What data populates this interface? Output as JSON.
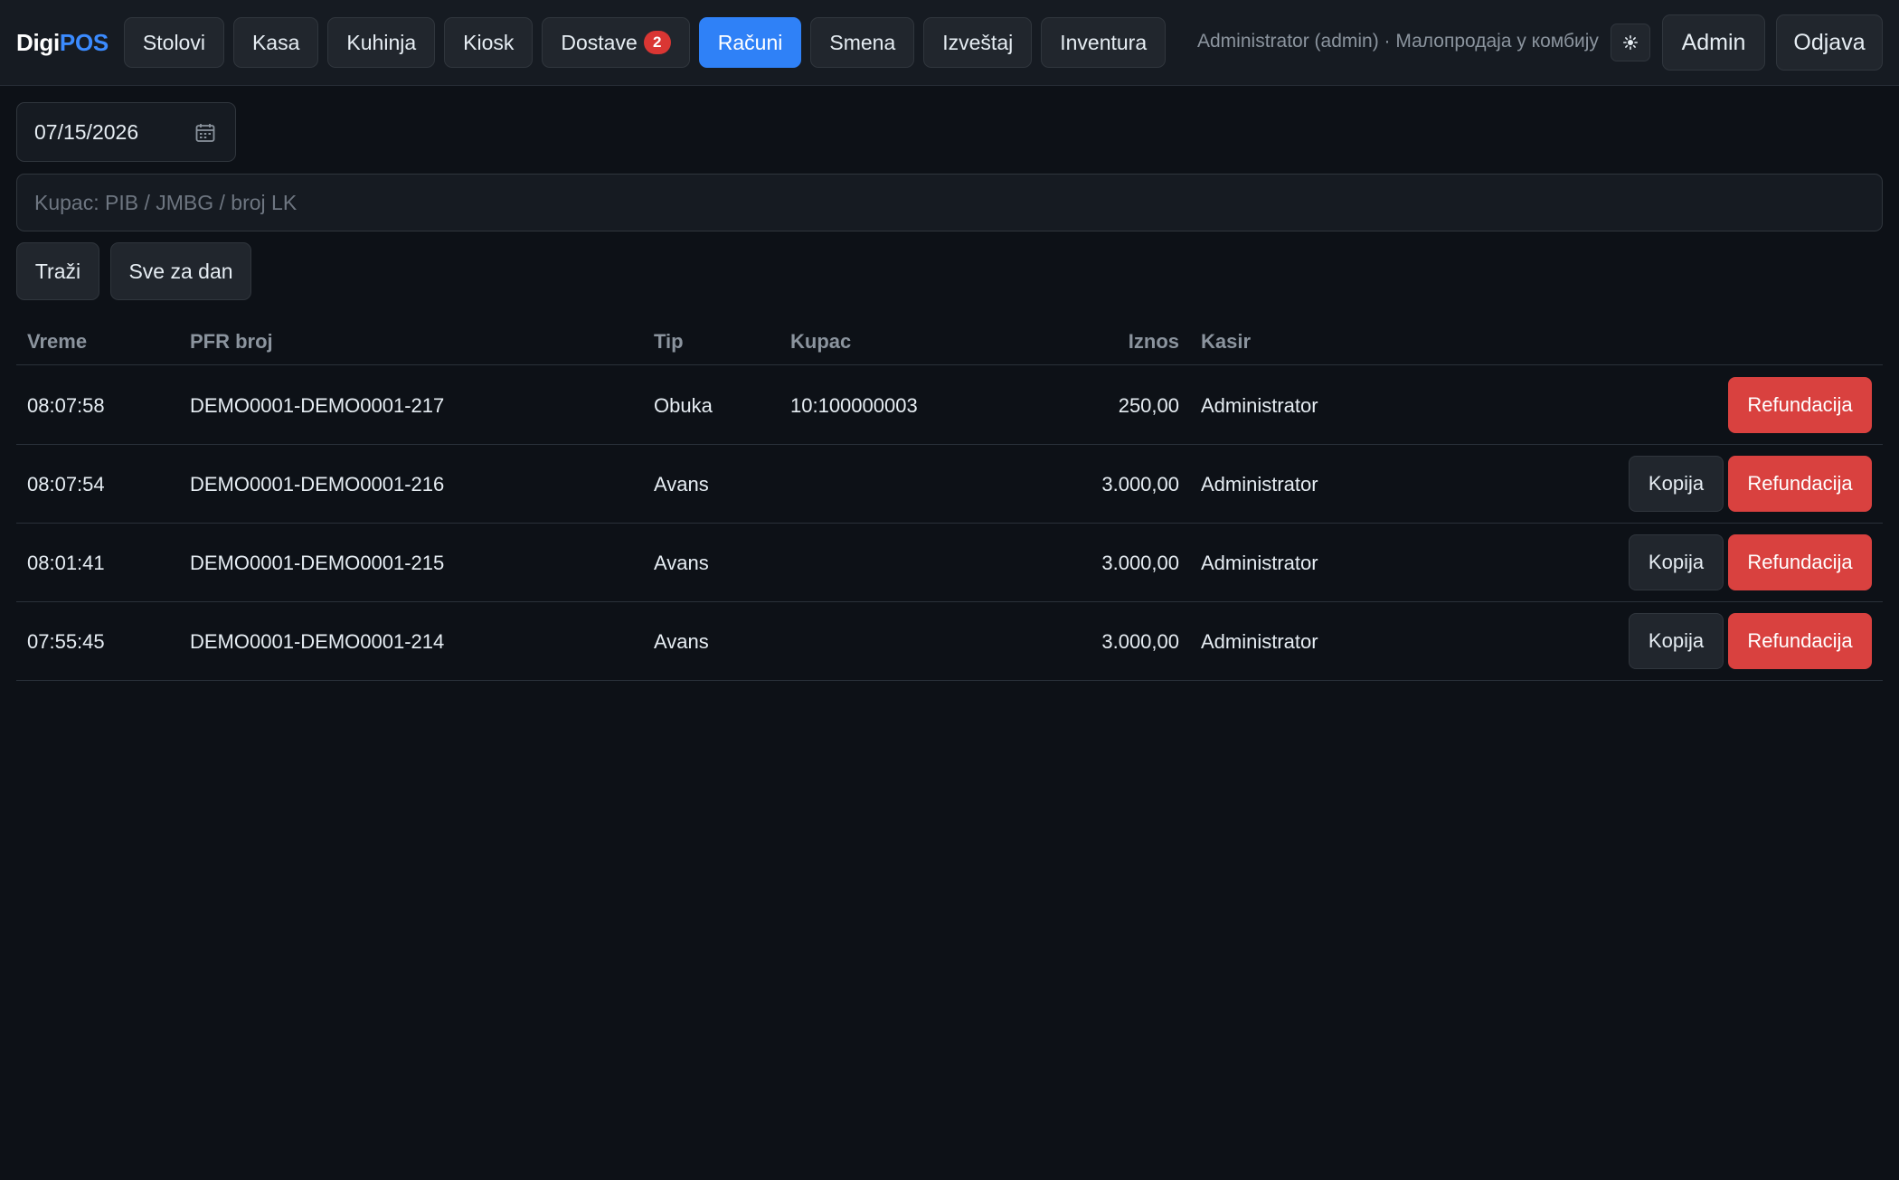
{
  "header": {
    "logo_part1": "Digi",
    "logo_part2": "POS",
    "nav": [
      {
        "label": "Stolovi"
      },
      {
        "label": "Kasa"
      },
      {
        "label": "Kuhinja"
      },
      {
        "label": "Kiosk"
      },
      {
        "label": "Dostave",
        "badge": "2"
      },
      {
        "label": "Računi",
        "active": true
      },
      {
        "label": "Smena"
      },
      {
        "label": "Izveštaj"
      },
      {
        "label": "Inventura"
      }
    ],
    "user_info": "Administrator (admin) · Малопродаја у комбију",
    "theme_icon": "sun-icon",
    "admin_label": "Admin",
    "logout_label": "Odjava"
  },
  "filters": {
    "date_value": "07/15/2026",
    "search_placeholder": "Kupac: PIB / JMBG / broj LK",
    "search_label": "Traži",
    "all_day_label": "Sve za dan"
  },
  "table": {
    "headers": {
      "time": "Vreme",
      "pfr": "PFR broj",
      "type": "Tip",
      "customer": "Kupac",
      "amount": "Iznos",
      "cashier": "Kasir"
    },
    "copy_label": "Kopija",
    "refund_label": "Refundacija",
    "rows": [
      {
        "time": "08:07:58",
        "pfr": "DEMO0001-DEMO0001-217",
        "type": "Obuka",
        "customer": "10:100000003",
        "amount": "250,00",
        "cashier": "Administrator",
        "has_copy": false
      },
      {
        "time": "08:07:54",
        "pfr": "DEMO0001-DEMO0001-216",
        "type": "Avans",
        "customer": "",
        "amount": "3.000,00",
        "cashier": "Administrator",
        "has_copy": true
      },
      {
        "time": "08:01:41",
        "pfr": "DEMO0001-DEMO0001-215",
        "type": "Avans",
        "customer": "",
        "amount": "3.000,00",
        "cashier": "Administrator",
        "has_copy": true
      },
      {
        "time": "07:55:45",
        "pfr": "DEMO0001-DEMO0001-214",
        "type": "Avans",
        "customer": "",
        "amount": "3.000,00",
        "cashier": "Administrator",
        "has_copy": true
      }
    ]
  },
  "colors": {
    "accent": "#2f81f7",
    "danger": "#d9413f",
    "background": "#0d1117"
  }
}
